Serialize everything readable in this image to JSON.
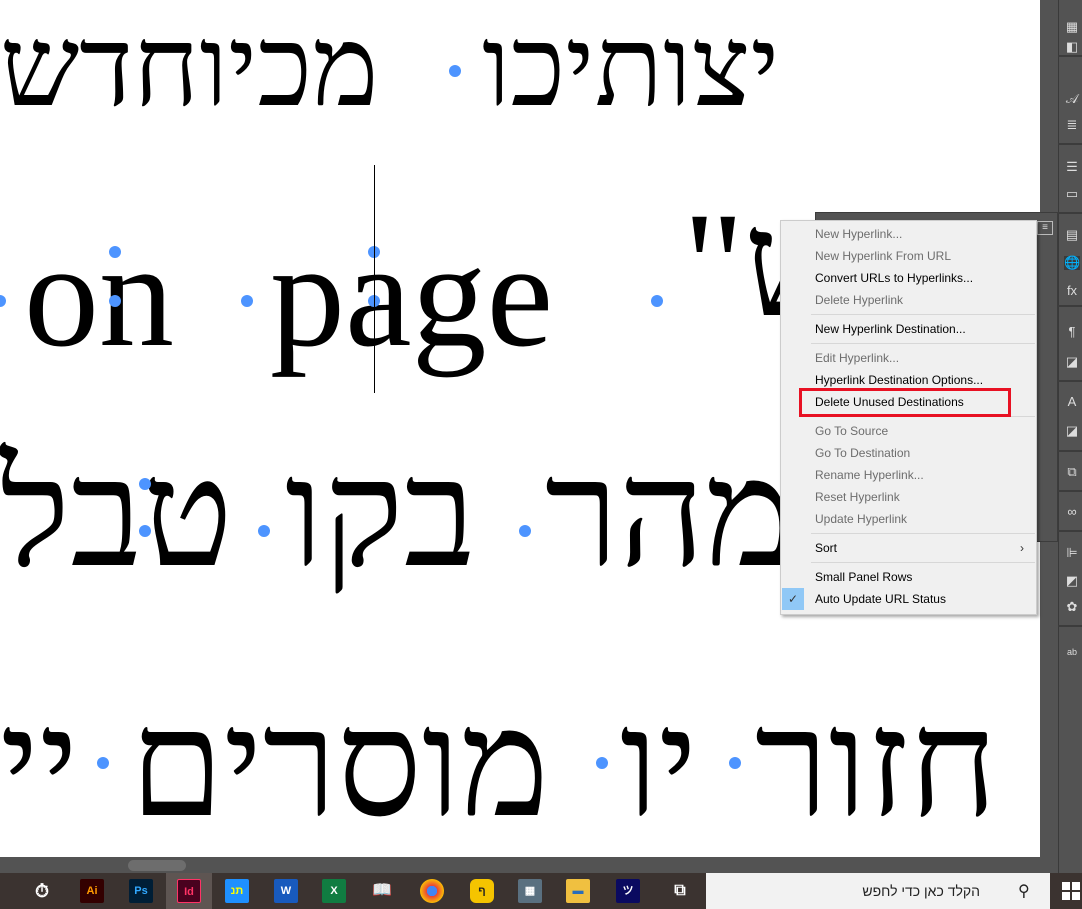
{
  "document": {
    "line1": [
      "מכיוחדש",
      "יצותיכו"
    ],
    "line2": {
      "quote": "\"ש",
      "word1": "on",
      "word2": "page"
    },
    "line3": [
      "מהר",
      "בקו",
      "טבל"
    ],
    "line4": [
      "חזור",
      "יו",
      "מוסרים",
      "יי"
    ]
  },
  "context_menu": {
    "items": [
      {
        "label": "New Hyperlink...",
        "enabled": false
      },
      {
        "label": "New Hyperlink From URL",
        "enabled": false
      },
      {
        "label": "Convert URLs to Hyperlinks...",
        "enabled": true
      },
      {
        "label": "Delete Hyperlink",
        "enabled": false
      },
      {
        "label": "New Hyperlink Destination...",
        "enabled": true
      },
      {
        "label": "Edit Hyperlink...",
        "enabled": false
      },
      {
        "label": "Hyperlink Destination Options...",
        "enabled": true
      },
      {
        "label": "Delete Unused Destinations",
        "enabled": true,
        "highlighted": true
      },
      {
        "label": "Go To Source",
        "enabled": false
      },
      {
        "label": "Go To Destination",
        "enabled": false
      },
      {
        "label": "Rename Hyperlink...",
        "enabled": false
      },
      {
        "label": "Reset Hyperlink",
        "enabled": false
      },
      {
        "label": "Update Hyperlink",
        "enabled": false
      },
      {
        "label": "Sort",
        "enabled": true,
        "submenu": true
      },
      {
        "label": "Small Panel Rows",
        "enabled": true
      },
      {
        "label": "Auto Update URL Status",
        "enabled": true,
        "checked": true
      }
    ]
  },
  "taskbar": {
    "apps": [
      "Ai",
      "Ps",
      "Id",
      "W",
      "X"
    ],
    "search_placeholder": "הקלד כאן כדי לחפש"
  },
  "colors": {
    "highlight": "#e81123",
    "dots": "#4d94ff",
    "check_bg": "#90c8f6"
  }
}
